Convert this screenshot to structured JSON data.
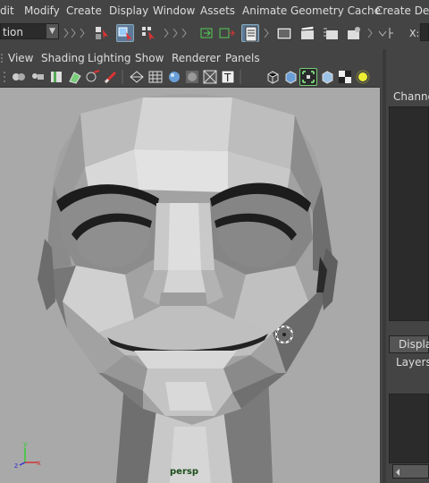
{
  "menubar": {
    "items": [
      "dit",
      "Modify",
      "Create",
      "Display",
      "Window",
      "Assets",
      "Animate",
      "Geometry Cache",
      "Create Defo"
    ]
  },
  "shelf": {
    "mode_value": "tion",
    "coord_label": "X:"
  },
  "viewport": {
    "menus": [
      "View",
      "Shading",
      "Lighting",
      "Show",
      "Renderer",
      "Panels"
    ],
    "camera_label": "persp",
    "axis_labels": {
      "y": "y",
      "x": "x",
      "z": "z"
    }
  },
  "right_panel": {
    "channel_label": "Channel",
    "display_tab": "Display",
    "layers_label": "Layers"
  },
  "colors": {
    "ui_bg": "#444444",
    "viewport_bg": "#a9a9a9",
    "highlight_blue": "#5d7a9a",
    "camera_label": "#1a4d1a"
  }
}
